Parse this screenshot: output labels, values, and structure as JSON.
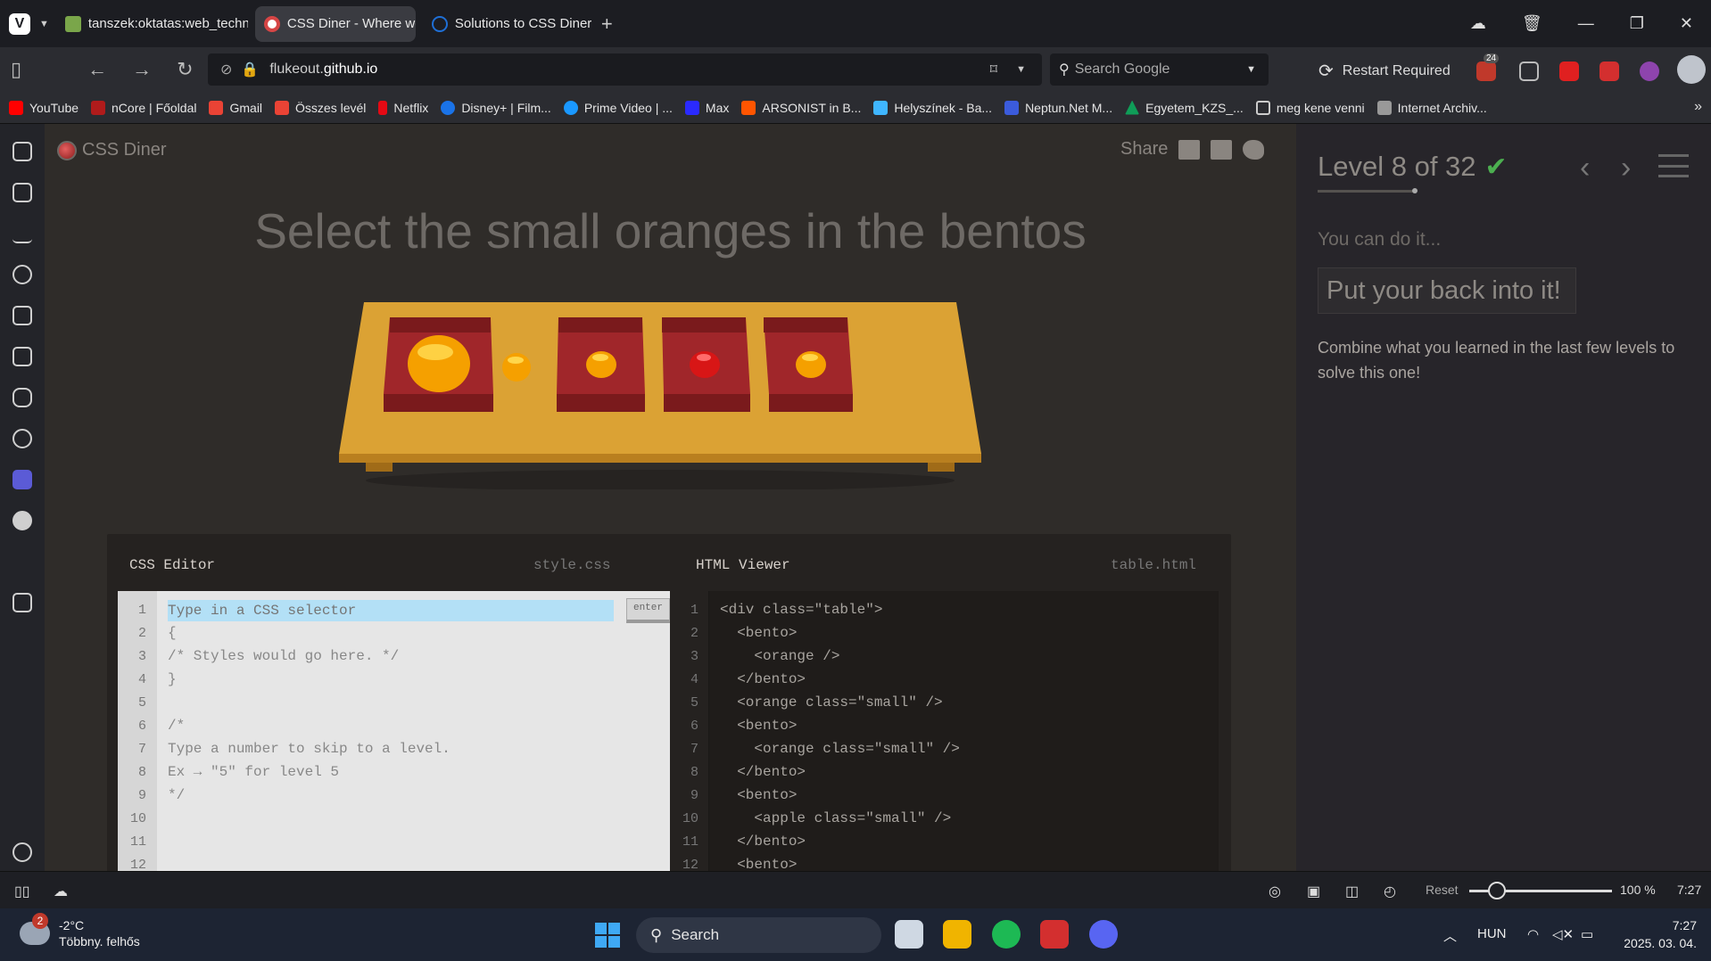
{
  "browser": {
    "tabs": [
      {
        "title": "tanszek:oktatas:web_technológiák",
        "active": false
      },
      {
        "title": "CSS Diner - Where we feast on CSS Selectors!",
        "active": true
      },
      {
        "title": "Solutions to CSS Diner | and more",
        "active": false
      }
    ],
    "url_prefix": "flukeout.",
    "url_host": "github.io",
    "search_placeholder": "Search Google",
    "restart_label": "Restart Required",
    "extension_badge": "24"
  },
  "bookmarks": [
    {
      "label": "YouTube",
      "color": "#ff0000"
    },
    {
      "label": "nCore | Főoldal",
      "color": "#b01b1b"
    },
    {
      "label": "Gmail",
      "color": "#ea4335"
    },
    {
      "label": "Összes levél",
      "color": "#ea4335"
    },
    {
      "label": "Netflix",
      "color": "#e50914"
    },
    {
      "label": "Disney+ | Film...",
      "color": "#1a73e8"
    },
    {
      "label": "Prime Video | ...",
      "color": "#1a98ff"
    },
    {
      "label": "Max",
      "color": "#2a2aff"
    },
    {
      "label": "ARSONIST in B...",
      "color": "#ff5500"
    },
    {
      "label": "Helyszínek - Ba...",
      "color": "#3fb6ff"
    },
    {
      "label": "Neptun.Net M...",
      "color": "#3b5bdb"
    },
    {
      "label": "Egyetem_KZS_...",
      "color": "#0f9d58"
    },
    {
      "label": "meg kene venni",
      "color": "#777777"
    },
    {
      "label": "Internet Archiv...",
      "color": "#999999"
    }
  ],
  "page": {
    "logo_text": "CSS Diner",
    "share_label": "Share",
    "order": "Select the small oranges in the bentos",
    "css_editor": {
      "title": "CSS Editor",
      "filename": "style.css",
      "input_placeholder": "Type in a CSS selector",
      "enter_label": "enter",
      "line_numbers": [
        "1",
        "2",
        "3",
        "4",
        "5",
        "6",
        "7",
        "8",
        "9",
        "10",
        "11",
        "12"
      ],
      "lines": [
        "",
        "{",
        "/* Styles would go here. */",
        "}",
        "",
        "/*",
        "Type a number to skip to a level.",
        "Ex → \"5\" for level 5",
        "*/",
        "",
        "",
        ""
      ]
    },
    "html_viewer": {
      "title": "HTML Viewer",
      "filename": "table.html",
      "line_numbers": [
        "1",
        "2",
        "3",
        "4",
        "5",
        "6",
        "7",
        "8",
        "9",
        "10",
        "11",
        "12"
      ],
      "lines": [
        "<div class=\"table\">",
        "  <bento>",
        "    <orange />",
        "  </bento>",
        "  <orange class=\"small\" />",
        "  <bento>",
        "    <orange class=\"small\" />",
        "  </bento>",
        "  <bento>",
        "    <apple class=\"small\" />",
        "  </bento>",
        "  <bento>"
      ]
    }
  },
  "sidebar": {
    "level_text": "Level 8 of 32",
    "check": "✔",
    "prev": "‹",
    "next": "›",
    "subtitle": "You can do it...",
    "hint": "Put your back into it!",
    "description": "Combine what you learned in the last few levels to solve this one!"
  },
  "statusbar": {
    "reset_label": "Reset",
    "zoom": "100 %",
    "time": "7:27"
  },
  "taskbar": {
    "weather_badge": "2",
    "temperature": "-2°C",
    "weather_text": "Többny. felhős",
    "search_label": "Search",
    "language": "HUN",
    "time": "7:27",
    "date": "2025. 03. 04."
  }
}
